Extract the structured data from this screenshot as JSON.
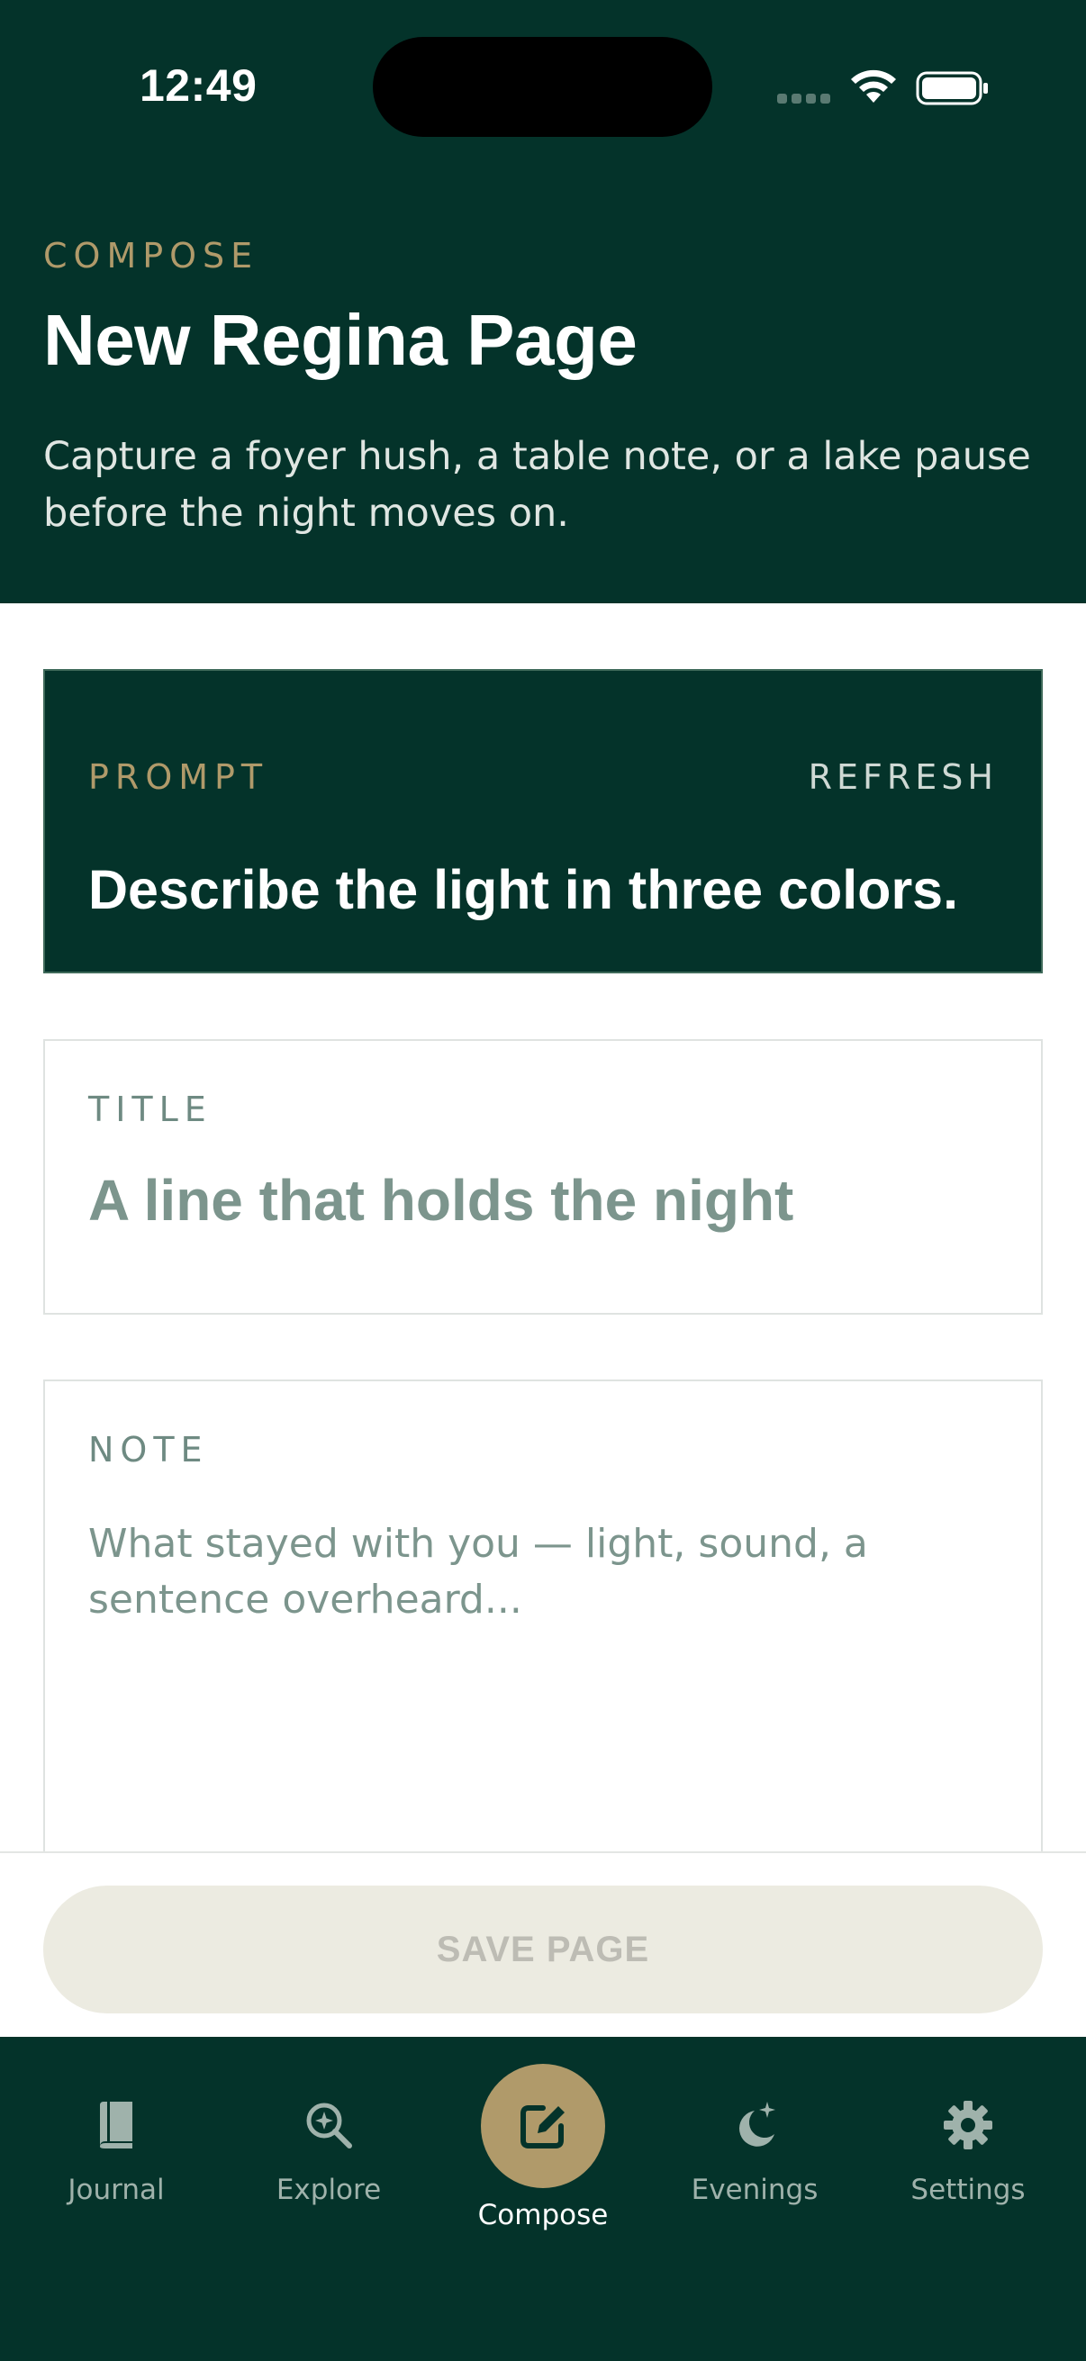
{
  "status_bar": {
    "time": "12:49"
  },
  "header": {
    "eyebrow": "COMPOSE",
    "title": "New Regina Page",
    "subtitle": "Capture a foyer hush, a table note, or a lake pause before the night moves on."
  },
  "prompt": {
    "label": "PROMPT",
    "refresh_label": "REFRESH",
    "text": "Describe the light in three colors."
  },
  "title_field": {
    "label": "TITLE",
    "placeholder": "A line that holds the night",
    "value": ""
  },
  "note_field": {
    "label": "NOTE",
    "placeholder": "What stayed with you — light, sound, a sentence overheard...",
    "value": ""
  },
  "save_button": {
    "label": "SAVE PAGE",
    "enabled": false
  },
  "tabbar": {
    "active": "Compose",
    "items": [
      {
        "label": "Journal",
        "icon": "book-icon"
      },
      {
        "label": "Explore",
        "icon": "search-sparkle-icon"
      },
      {
        "label": "Compose",
        "icon": "edit-square-icon"
      },
      {
        "label": "Evenings",
        "icon": "moon-sparkle-icon"
      },
      {
        "label": "Settings",
        "icon": "gear-icon"
      }
    ]
  },
  "colors": {
    "primary_dark": "#04332a",
    "accent_gold": "#b09a6a",
    "muted_text": "#7c958d",
    "disabled_button": "#ecebe1"
  }
}
